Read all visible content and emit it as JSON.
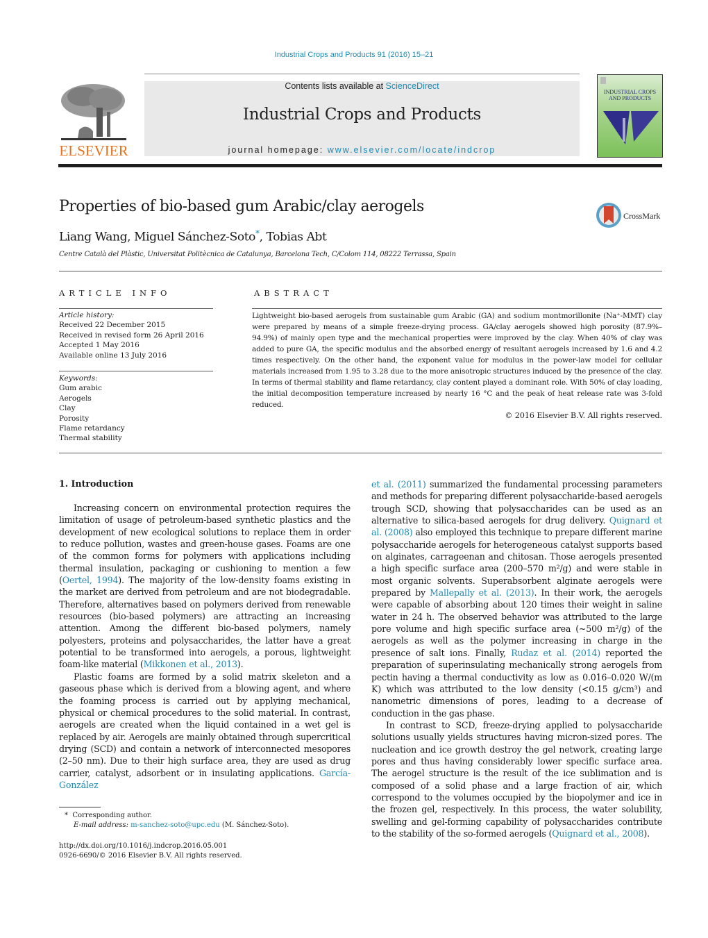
{
  "header": {
    "journal_ref": "Industrial Crops and Products 91 (2016) 15–21",
    "contents_prefix": "Contents lists available at ",
    "contents_link": "ScienceDirect",
    "journal_title": "Industrial Crops and Products",
    "homepage_prefix": "journal homepage: ",
    "homepage_link": "www.elsevier.com/locate/indcrop",
    "publisher_logo_text": "ELSEVIER",
    "cover_title": "INDUSTRIAL CROPS AND PRODUCTS",
    "colors": {
      "link": "#1f8ab3",
      "elsevier_orange": "#e9711c",
      "masthead_bg": "#e9e9e9"
    }
  },
  "article": {
    "title": "Properties of bio-based gum Arabic/clay aerogels",
    "authors": [
      {
        "name": "Liang Wang",
        "sep": ", "
      },
      {
        "name": "Miguel Sánchez-Soto",
        "mark": "*",
        "sep": ", "
      },
      {
        "name": "Tobias Abt",
        "sep": ""
      }
    ],
    "affiliation": "Centre Català del Plàstic, Universitat Politècnica de Catalunya, Barcelona Tech, C/Colom 114, 08222 Terrassa, Spain",
    "crossmark_label": "CrossMark"
  },
  "article_info": {
    "heading": "ARTICLE INFO",
    "history_label": "Article history:",
    "history": [
      "Received 22 December 2015",
      "Received in revised form 26 April 2016",
      "Accepted 1 May 2016",
      "Available online 13 July 2016"
    ],
    "keywords_label": "Keywords:",
    "keywords": [
      "Gum arabic",
      "Aerogels",
      "Clay",
      "Porosity",
      "Flame retardancy",
      "Thermal stability"
    ]
  },
  "abstract": {
    "heading": "ABSTRACT",
    "text": "Lightweight bio-based aerogels from sustainable gum Arabic (GA) and sodium montmorillonite (Na⁺-MMT) clay were prepared by means of a simple freeze-drying process. GA/clay aerogels showed high porosity (87.9%–94.9%) of mainly open type and the mechanical properties were improved by the clay. When 40% of clay was added to pure GA, the specific modulus and the absorbed energy of resultant aerogels increased by 1.6 and 4.2 times respectively. On the other hand, the exponent value for modulus in the power-law model for cellular materials increased from 1.95 to 3.28 due to the more anisotropic structures induced by the presence of the clay. In terms of thermal stability and flame retardancy, clay content played a dominant role. With 50% of clay loading, the initial decomposition temperature increased by nearly 16 °C and the peak of heat release rate was 3-fold reduced.",
    "copyright": "© 2016 Elsevier B.V. All rights reserved."
  },
  "body": {
    "section_heading": "1.  Introduction",
    "left_paragraphs": [
      [
        {
          "t": "Increasing concern on environmental protection requires the limitation of usage of petroleum-based synthetic plastics and the development of new ecological solutions to replace them in order to reduce pollution, wastes and green-house gases. Foams are one of the common forms for polymers with applications including thermal insulation, packaging or cushioning to mention a few ("
        },
        {
          "t": "Oertel, 1994",
          "link": true
        },
        {
          "t": "). The majority of the low-density foams existing in the market are derived from petroleum and are not biodegradable. Therefore, alternatives based on polymers derived from renewable resources (bio-based polymers) are attracting an increasing attention. Among the different bio-based polymers, namely polyesters, proteins and polysaccharides, the latter have a great potential to be transformed into aerogels, a porous, lightweight foam-like material ("
        },
        {
          "t": "Mikkonen et al., 2013",
          "link": true
        },
        {
          "t": ")."
        }
      ],
      [
        {
          "t": "Plastic foams are formed by a solid matrix skeleton and a gaseous phase which is derived from a blowing agent, and where the foaming process is carried out by applying mechanical, physical or chemical procedures to the solid material. In contrast, aerogels are created when the liquid contained in a wet gel is replaced by air. Aerogels are mainly obtained through supercritical drying (SCD) and contain a network of interconnected mesopores (2–50 nm). Due to their high surface area, they are used as drug carrier, catalyst, adsorbent or in insulating applications. "
        },
        {
          "t": "García-González",
          "link": true
        }
      ]
    ],
    "right_paragraphs": [
      [
        {
          "t": "et al. (2011)",
          "link": true
        },
        {
          "t": " summarized the fundamental processing parameters and methods for preparing different polysaccharide-based aerogels trough SCD, showing that polysaccharides can be used as an alternative to silica-based aerogels for drug delivery. "
        },
        {
          "t": "Quignard et al. (2008)",
          "link": true
        },
        {
          "t": " also employed this technique to prepare different marine polysaccharide aerogels for heterogeneous catalyst supports based on alginates, carrageenan and chitosan. Those aerogels presented a high specific surface area (200–570 m²/g) and were stable in most organic solvents. Superabsorbent alginate aerogels were prepared by "
        },
        {
          "t": "Mallepally et al. (2013)",
          "link": true
        },
        {
          "t": ". In their work, the aerogels were capable of absorbing about 120 times their weight in saline water in 24 h. The observed behavior was attributed to the large pore volume and high specific surface area (~500 m²/g) of the aerogels as well as the polymer increasing in charge in the presence of salt ions. Finally, "
        },
        {
          "t": "Rudaz et al. (2014)",
          "link": true
        },
        {
          "t": " reported the preparation of superinsulating mechanically strong aerogels from pectin having a thermal conductivity as low as 0.016–0.020 W/(m K) which was attributed to the low density (<0.15 g/cm³) and nanometric dimensions of pores, leading to a decrease of conduction in the gas phase."
        }
      ],
      [
        {
          "t": "In contrast to SCD, freeze-drying applied to polysaccharide solutions usually yields structures having micron-sized pores. The nucleation and ice growth destroy the gel network, creating large pores and thus having considerably lower specific surface area. The aerogel structure is the result of the ice sublimation and is composed of a solid phase and a large fraction of air, which correspond to the volumes occupied by the biopolymer and ice in the frozen gel, respectively. In this process, the water solubility, swelling and gel-forming capability of polysaccharides contribute to the stability of the so-formed aerogels ("
        },
        {
          "t": "Quignard et al., 2008",
          "link": true
        },
        {
          "t": ")."
        }
      ]
    ]
  },
  "footnotes": {
    "corresponding_mark": "*",
    "corresponding_text": "Corresponding author.",
    "email_label": "E-mail address:",
    "email": "m-sanchez-soto@upc.edu",
    "email_suffix": " (M. Sánchez-Soto).",
    "doi": "http://dx.doi.org/10.1016/j.indcrop.2016.05.001",
    "issn_line": "0926-6690/© 2016 Elsevier B.V. All rights reserved."
  }
}
